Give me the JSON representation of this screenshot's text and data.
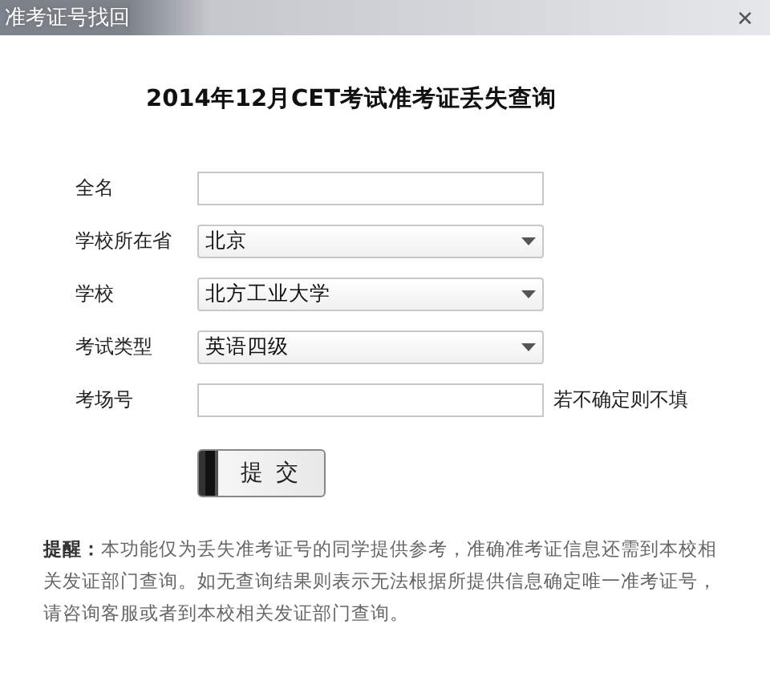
{
  "window": {
    "title": "准考证号找回",
    "close": "✕"
  },
  "heading": "2014年12月CET考试准考证丢失查询",
  "fields": [
    {
      "kind": "text",
      "label": "全名"
    },
    {
      "kind": "select",
      "label": "学校所在省",
      "value": "北京"
    },
    {
      "kind": "select",
      "label": "学校",
      "value": "北方工业大学"
    },
    {
      "kind": "select",
      "label": "考试类型",
      "value": "英语四级"
    },
    {
      "kind": "text",
      "label": "考场号",
      "hint": "若不确定则不填"
    }
  ],
  "submit": "提 交",
  "note": "**提醒：**本功能仅为丢失准考证号的同学提供参考，准确准考证信息还需到本校相关发证部门查询。如无查询结果则表示无法根据所提供信息确定唯一准考证号，请咨询客服或者到本校相关发证部门查询。"
}
